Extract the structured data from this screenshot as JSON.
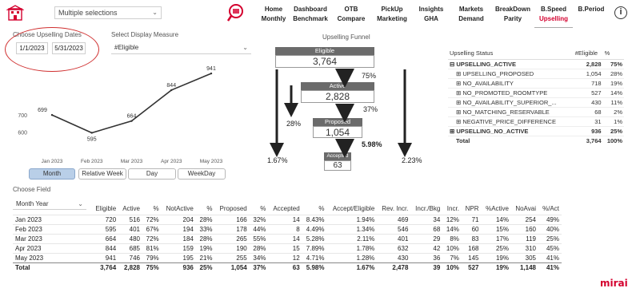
{
  "header": {
    "hotel_selector": "Multiple selections",
    "nav": [
      {
        "top": "Home",
        "bottom": "Monthly"
      },
      {
        "top": "Dashboard",
        "bottom": "Benchmark"
      },
      {
        "top": "OTB",
        "bottom": "Compare"
      },
      {
        "top": "PickUp",
        "bottom": "Marketing"
      },
      {
        "top": "Insights",
        "bottom": "GHA"
      },
      {
        "top": "Markets",
        "bottom": "Demand"
      },
      {
        "top": "BreakDown",
        "bottom": "Parity"
      },
      {
        "top": "B.Speed",
        "bottom": "Upselling"
      },
      {
        "top": "B.Period",
        "bottom": ""
      }
    ],
    "info_symbol": "i"
  },
  "dates": {
    "label": "Choose Upselling Dates",
    "start": "1/1/2023",
    "end": "5/31/2023"
  },
  "measure": {
    "label": "Select Display Measure",
    "value": "#Eligible"
  },
  "chart_data": {
    "type": "line",
    "categories": [
      "Jan 2023",
      "Feb 2023",
      "Mar 2023",
      "Apr 2023",
      "May 2023"
    ],
    "values": [
      699,
      595,
      664,
      844,
      941
    ],
    "yticks": [
      700,
      600
    ],
    "ylim": [
      560,
      960
    ],
    "color": "#333333"
  },
  "granularity_buttons": [
    "Month",
    "Relative Week",
    "Day",
    "WeekDay"
  ],
  "funnel": {
    "title": "Upselling Funnel",
    "stages": [
      {
        "name": "Eligible",
        "value": "3,764"
      },
      {
        "name": "Active",
        "value": "2,828"
      },
      {
        "name": "Proposed",
        "value": "1,054"
      },
      {
        "name": "Accepted",
        "value": "63"
      }
    ],
    "rates": [
      "75%",
      "37%",
      "5.98%"
    ],
    "side_rates": [
      "28%",
      "1.67%",
      "2.23%"
    ]
  },
  "status_table": {
    "headers": [
      "Upselling Status",
      "#Eligible",
      "%"
    ],
    "rows": [
      {
        "label": "UPSELLING_ACTIVE",
        "eligible": "2,828",
        "pct": "75%",
        "level": "group"
      },
      {
        "label": "UPSELLING_PROPOSED",
        "eligible": "1,054",
        "pct": "28%",
        "level": "item"
      },
      {
        "label": "NO_AVAILABILITY",
        "eligible": "718",
        "pct": "19%",
        "level": "item"
      },
      {
        "label": "NO_PROMOTED_ROOMTYPE",
        "eligible": "527",
        "pct": "14%",
        "level": "item"
      },
      {
        "label": "NO_AVAILABILITY_SUPERIOR_...",
        "eligible": "430",
        "pct": "11%",
        "level": "item"
      },
      {
        "label": "NO_MATCHING_RESERVABLE",
        "eligible": "68",
        "pct": "2%",
        "level": "item"
      },
      {
        "label": "NEGATIVE_PRICE_DIFFERENCE",
        "eligible": "31",
        "pct": "1%",
        "level": "item"
      },
      {
        "label": "UPSELLING_NO_ACTIVE",
        "eligible": "936",
        "pct": "25%",
        "level": "group"
      }
    ],
    "total": {
      "label": "Total",
      "eligible": "3,764",
      "pct": "100%"
    }
  },
  "field": {
    "label": "Choose Field",
    "value": "Month Year"
  },
  "data_table": {
    "headers": [
      "Eligible",
      "Active",
      "%",
      "NotActive",
      "%",
      "Proposed",
      "%",
      "Accepted",
      "%",
      "Accept/Eligible",
      "Rev. Incr.",
      "Incr./Bkg",
      "Incr.",
      "NPR",
      "%Active",
      "NoAvai",
      "%/Act"
    ],
    "rows": [
      [
        "Jan 2023",
        "720",
        "516",
        "72%",
        "204",
        "28%",
        "166",
        "32%",
        "14",
        "8.43%",
        "1.94%",
        "469",
        "34",
        "12%",
        "71",
        "14%",
        "254",
        "49%"
      ],
      [
        "Feb 2023",
        "595",
        "401",
        "67%",
        "194",
        "33%",
        "178",
        "44%",
        "8",
        "4.49%",
        "1.34%",
        "546",
        "68",
        "14%",
        "60",
        "15%",
        "160",
        "40%"
      ],
      [
        "Mar 2023",
        "664",
        "480",
        "72%",
        "184",
        "28%",
        "265",
        "55%",
        "14",
        "5.28%",
        "2.11%",
        "401",
        "29",
        "8%",
        "83",
        "17%",
        "119",
        "25%"
      ],
      [
        "Apr 2023",
        "844",
        "685",
        "81%",
        "159",
        "19%",
        "190",
        "28%",
        "15",
        "7.89%",
        "1.78%",
        "632",
        "42",
        "10%",
        "168",
        "25%",
        "310",
        "45%"
      ],
      [
        "May 2023",
        "941",
        "746",
        "79%",
        "195",
        "21%",
        "255",
        "34%",
        "12",
        "4.71%",
        "1.28%",
        "430",
        "36",
        "7%",
        "145",
        "19%",
        "305",
        "41%"
      ]
    ],
    "total": [
      "Total",
      "3,764",
      "2,828",
      "75%",
      "936",
      "25%",
      "1,054",
      "37%",
      "63",
      "5.98%",
      "1.67%",
      "2,478",
      "39",
      "10%",
      "527",
      "19%",
      "1,148",
      "41%"
    ]
  },
  "brand": "mirai",
  "colors": {
    "accent": "#d4002e",
    "funnel_header": "#6b6b6b",
    "selected_button": "#b9cfe8"
  }
}
